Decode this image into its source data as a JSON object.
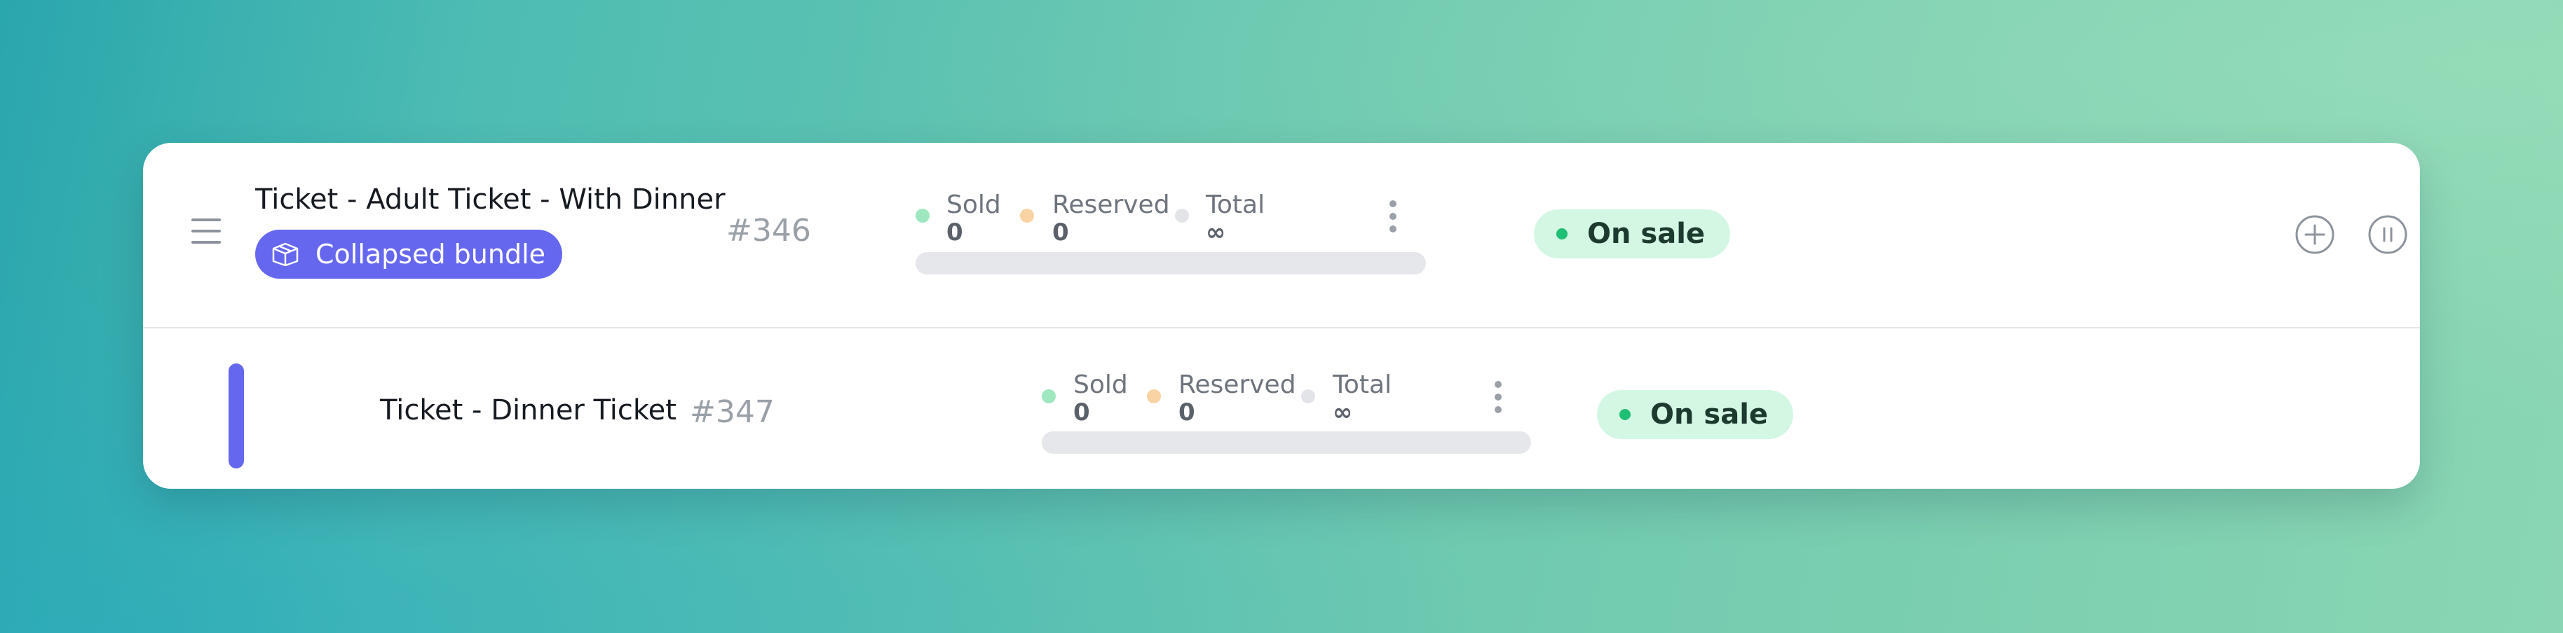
{
  "colors": {
    "accent": "#6667ef",
    "sold_dot": "#9fe7bf",
    "reserved_dot": "#f9d3a3",
    "total_dot": "#e3e4e7",
    "status_bg": "#d4f7e4",
    "status_dot": "#1fbf75"
  },
  "tickets": [
    {
      "title": "Ticket - Adult Ticket - With Dinner",
      "badge": {
        "label": "Collapsed bundle",
        "icon": "package-icon"
      },
      "id": "#346",
      "stats": {
        "sold_label": "Sold",
        "sold_value": "0",
        "reserved_label": "Reserved",
        "reserved_value": "0",
        "total_label": "Total",
        "total_value": "∞"
      },
      "progress": 0,
      "status": "On sale",
      "actions": [
        "add-icon",
        "pause-icon",
        "trash-icon",
        "chevron-right-icon"
      ]
    },
    {
      "title": "Ticket - Dinner Ticket",
      "id": "#347",
      "stats": {
        "sold_label": "Sold",
        "sold_value": "0",
        "reserved_label": "Reserved",
        "reserved_value": "0",
        "total_label": "Total",
        "total_value": "∞"
      },
      "progress": 0,
      "status": "On sale",
      "actions": [
        "trash-icon",
        "chevron-right-icon"
      ]
    }
  ]
}
